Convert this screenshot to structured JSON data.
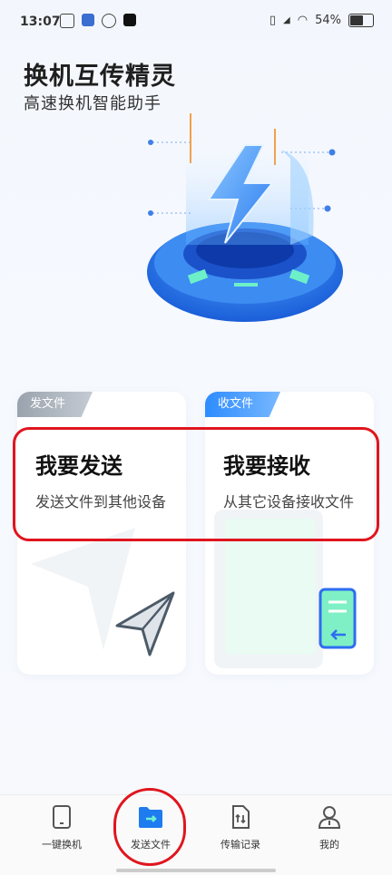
{
  "status": {
    "time": "13:07",
    "battery": "54%"
  },
  "header": {
    "title": "换机互传精灵",
    "subtitle": "高速换机智能助手"
  },
  "cards": {
    "send": {
      "tag": "发文件",
      "title": "我要发送",
      "desc": "发送文件到其他设备"
    },
    "receive": {
      "tag": "收文件",
      "title": "我要接收",
      "desc": "从其它设备接收文件"
    }
  },
  "nav": {
    "items": [
      {
        "label": "一键换机",
        "icon": "phone-icon"
      },
      {
        "label": "发送文件",
        "icon": "folder-send-icon",
        "active": true
      },
      {
        "label": "传输记录",
        "icon": "transfer-record-icon"
      },
      {
        "label": "我的",
        "icon": "user-icon"
      }
    ]
  },
  "colors": {
    "accent": "#2d8cff",
    "highlight": "#e0151e"
  }
}
